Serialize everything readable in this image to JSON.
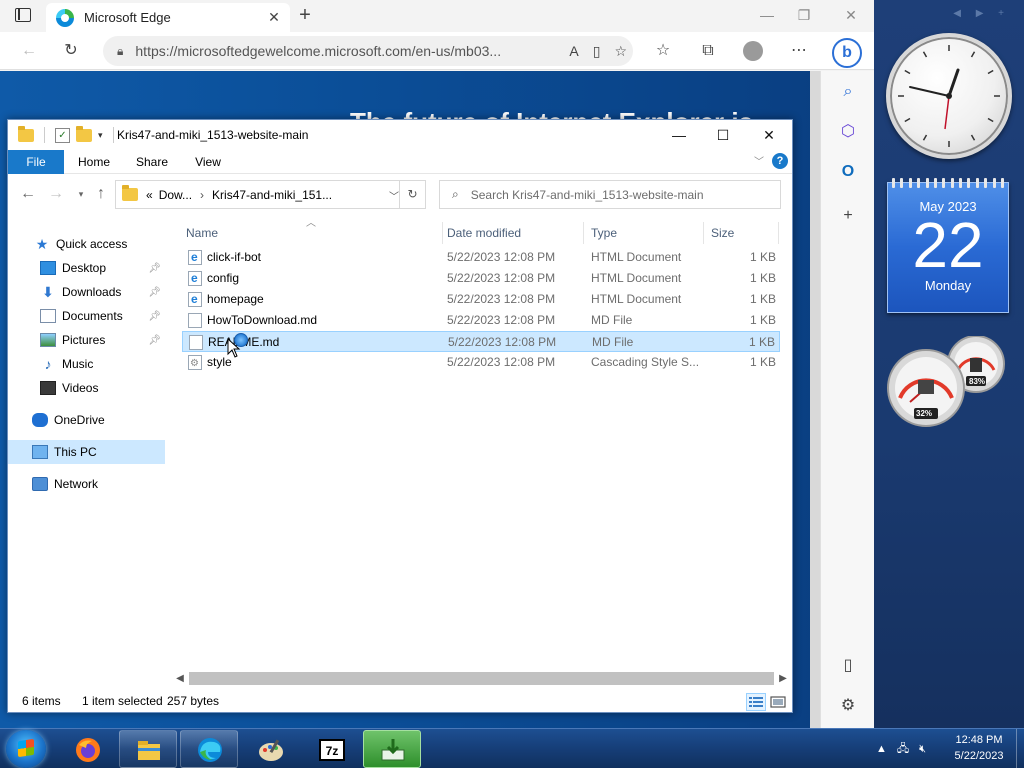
{
  "browser": {
    "tab_title": "Microsoft Edge",
    "url": "https://microsoftedgewelcome.microsoft.com/en-us/mb03...",
    "page_heading": "The future of Internet Explorer is"
  },
  "explorer": {
    "title": "Kris47-and-miki_1513-website-main",
    "ribbon_tabs": [
      "File",
      "Home",
      "Share",
      "View"
    ],
    "breadcrumb": [
      "Dow...",
      "Kris47-and-miki_151..."
    ],
    "breadcrumb_prefix": "«",
    "search_placeholder": "Search Kris47-and-miki_1513-website-main",
    "columns": {
      "name": "Name",
      "date": "Date modified",
      "type": "Type",
      "size": "Size"
    },
    "nav": [
      {
        "label": "Quick access",
        "icon": "star-icon"
      },
      {
        "label": "Desktop",
        "icon": "desktop-folder-icon",
        "pinned": true
      },
      {
        "label": "Downloads",
        "icon": "downloads-folder-icon",
        "pinned": true
      },
      {
        "label": "Documents",
        "icon": "documents-folder-icon",
        "pinned": true
      },
      {
        "label": "Pictures",
        "icon": "pictures-folder-icon",
        "pinned": true
      },
      {
        "label": "Music",
        "icon": "music-folder-icon"
      },
      {
        "label": "Videos",
        "icon": "videos-folder-icon"
      },
      {
        "label": "OneDrive",
        "icon": "onedrive-icon"
      },
      {
        "label": "This PC",
        "icon": "this-pc-icon",
        "selected": true
      },
      {
        "label": "Network",
        "icon": "network-icon"
      }
    ],
    "files": [
      {
        "name": "click-if-bot",
        "date": "5/22/2023 12:08 PM",
        "type": "HTML Document",
        "size": "1 KB",
        "icon": "html-file-icon"
      },
      {
        "name": "config",
        "date": "5/22/2023 12:08 PM",
        "type": "HTML Document",
        "size": "1 KB",
        "icon": "html-file-icon"
      },
      {
        "name": "homepage",
        "date": "5/22/2023 12:08 PM",
        "type": "HTML Document",
        "size": "1 KB",
        "icon": "html-file-icon"
      },
      {
        "name": "HowToDownload.md",
        "date": "5/22/2023 12:08 PM",
        "type": "MD File",
        "size": "1 KB",
        "icon": "md-file-icon"
      },
      {
        "name": "README.md",
        "date": "5/22/2023 12:08 PM",
        "type": "MD File",
        "size": "1 KB",
        "icon": "md-file-icon",
        "selected": true
      },
      {
        "name": "style",
        "date": "5/22/2023 12:08 PM",
        "type": "Cascading Style S...",
        "size": "1 KB",
        "icon": "css-file-icon"
      }
    ],
    "status": {
      "item_count": "6 items",
      "selection": "1 item selected",
      "selection_size": "257 bytes"
    }
  },
  "gadgets": {
    "calendar": {
      "month": "May 2023",
      "day": "22",
      "weekday": "Monday"
    },
    "meter": {
      "cpu": "32%",
      "memory": "83%"
    }
  },
  "taskbar": {
    "apps": [
      "firefox-icon",
      "file-explorer-icon",
      "edge-icon",
      "paint-icon",
      "7zip-icon",
      "download-installer-icon"
    ],
    "time": "12:48 PM",
    "date": "5/22/2023"
  },
  "colors": {
    "selection": "#cce8ff",
    "file_tab": "#1979ca",
    "taskbar": "#163e78",
    "calendar": "#2a6ad4"
  }
}
